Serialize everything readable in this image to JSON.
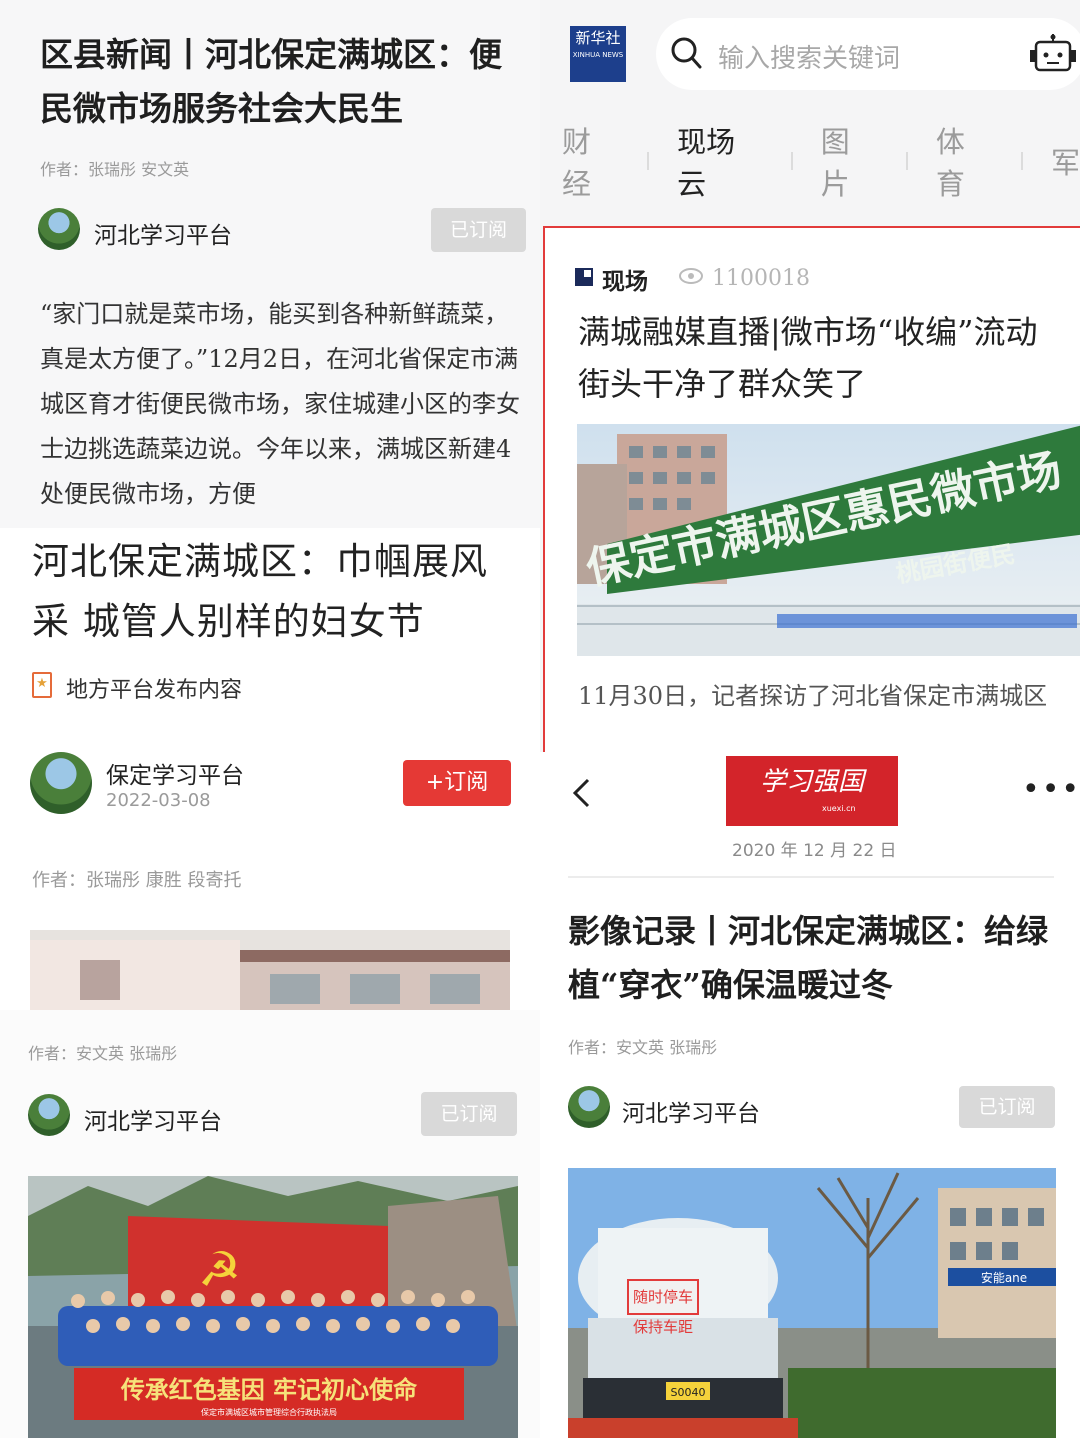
{
  "panel_tl": {
    "title": "区县新闻丨河北保定满城区：便民微市场服务社会大民生",
    "author": "作者：张瑞彤 安文英",
    "source": "河北学习平台",
    "subscribe_label": "已订阅",
    "body": "“家门口就是菜市场，能买到各种新鲜蔬菜，真是太方便了。”12月2日，在河北省保定市满城区育才街便民微市场，家住城建小区的李女士边挑选蔬菜边说。今年以来，满城区新建4处便民微市场，方便"
  },
  "panel_ml": {
    "headline": "河北保定满城区：巾帼展风采 城管人别样的妇女节",
    "publisher_note": "地方平台发布内容"
  },
  "panel_tr": {
    "logo_cn": "新华社",
    "logo_en": "XINHUA NEWS",
    "search_placeholder": "输入搜索关键词",
    "tabs": [
      "财经",
      "现场云",
      "图片",
      "体育",
      "军"
    ],
    "active_tab": "现场云",
    "card": {
      "tag": "现场",
      "views": "1100018",
      "title_line1": "满城融媒直播|微市场“收编”流动",
      "title_line2": "街头干净了群众笑了",
      "banner_main": "保定市满城区惠民微市场",
      "banner_sub": "桃园街便民",
      "body": "11月30日，记者探访了河北省保定市满城区"
    }
  },
  "panel_ll": {
    "source": "保定学习平台",
    "date": "2022-03-08",
    "follow_label": "+订阅",
    "author": "作者：张瑞彤 康胜 段寄托"
  },
  "panel_bl": {
    "author": "作者：安文英 张瑞彤",
    "source": "河北学习平台",
    "subscribe_label": "已订阅",
    "banner_text": "传承红色基因  牢记初心使命",
    "banner_small": "保定市满城区城市管理综合行政执法局"
  },
  "panel_br": {
    "logo_cn": "学习强国",
    "logo_en": "xuexi.cn",
    "date": "2020 年 12 月 22 日",
    "title": "影像记录丨河北保定满城区：给绿植“穿衣”确保温暖过冬",
    "author": "作者：安文英 张瑞彤",
    "source": "河北学习平台",
    "subscribe_label": "已订阅",
    "truck_sign1": "随时停车",
    "truck_sign2": "保持车距",
    "plate": "S0040",
    "shop_sign": "安能ane"
  },
  "icons": [
    "search-icon",
    "robot-icon",
    "eye-icon",
    "back-arrow-icon",
    "more-icon",
    "publisher-badge-icon"
  ],
  "colors": {
    "accent_red": "#e53935",
    "xinhua_blue": "#1d3f8c",
    "subscribed_gray": "#d9d9d9"
  }
}
